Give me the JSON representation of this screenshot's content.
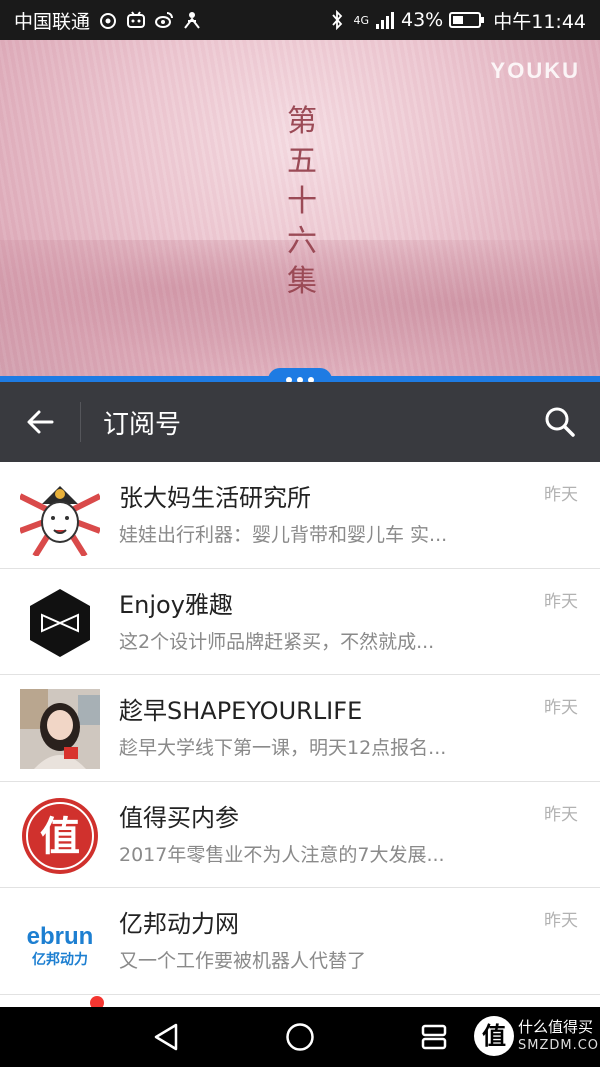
{
  "status_bar": {
    "carrier": "中国联通",
    "battery_label": "43%",
    "battery_level": 0.43,
    "network": "4G",
    "time": "中午11:44",
    "icons": [
      "weibo-icon",
      "bilibili-icon",
      "weibo-icon",
      "app-icon",
      "bluetooth-icon",
      "signal-icon",
      "battery-icon"
    ]
  },
  "video": {
    "episode_title": [
      "第",
      "五",
      "十",
      "六",
      "集"
    ],
    "logo": "YOUKU"
  },
  "toolbar": {
    "title": "订阅号"
  },
  "subscriptions": [
    {
      "name": "张大妈生活研究所",
      "preview": "娃娃出行利器：婴儿背带和婴儿车 实...",
      "time": "昨天",
      "avatar": "zhangdama-avatar"
    },
    {
      "name": "Enjoy雅趣",
      "preview": "这2个设计师品牌赶紧买，不然就成...",
      "time": "昨天",
      "avatar": "enjoy-avatar"
    },
    {
      "name": "趁早SHAPEYOURLIFE",
      "preview": "趁早大学线下第一课，明天12点报名...",
      "time": "昨天",
      "avatar": "photo-avatar"
    },
    {
      "name": "值得买内参",
      "preview": "2017年零售业不为人注意的7大发展...",
      "time": "昨天",
      "avatar": "zhi-avatar"
    },
    {
      "name": "亿邦动力网",
      "preview": "又一个工作要被机器人代替了",
      "time": "昨天",
      "avatar": "ebrun-avatar"
    }
  ],
  "avatar_text": {
    "zhi": "值",
    "ebrun_top": "ebrun",
    "ebrun_bottom": "亿邦动力"
  },
  "watermark": {
    "badge": "值",
    "name": "什么值得买",
    "url": "SMZDM.COM"
  },
  "colors": {
    "accent_blue": "#1e7be3",
    "toolbar_bg": "#393a3f",
    "zhi_red": "#d0312d"
  }
}
